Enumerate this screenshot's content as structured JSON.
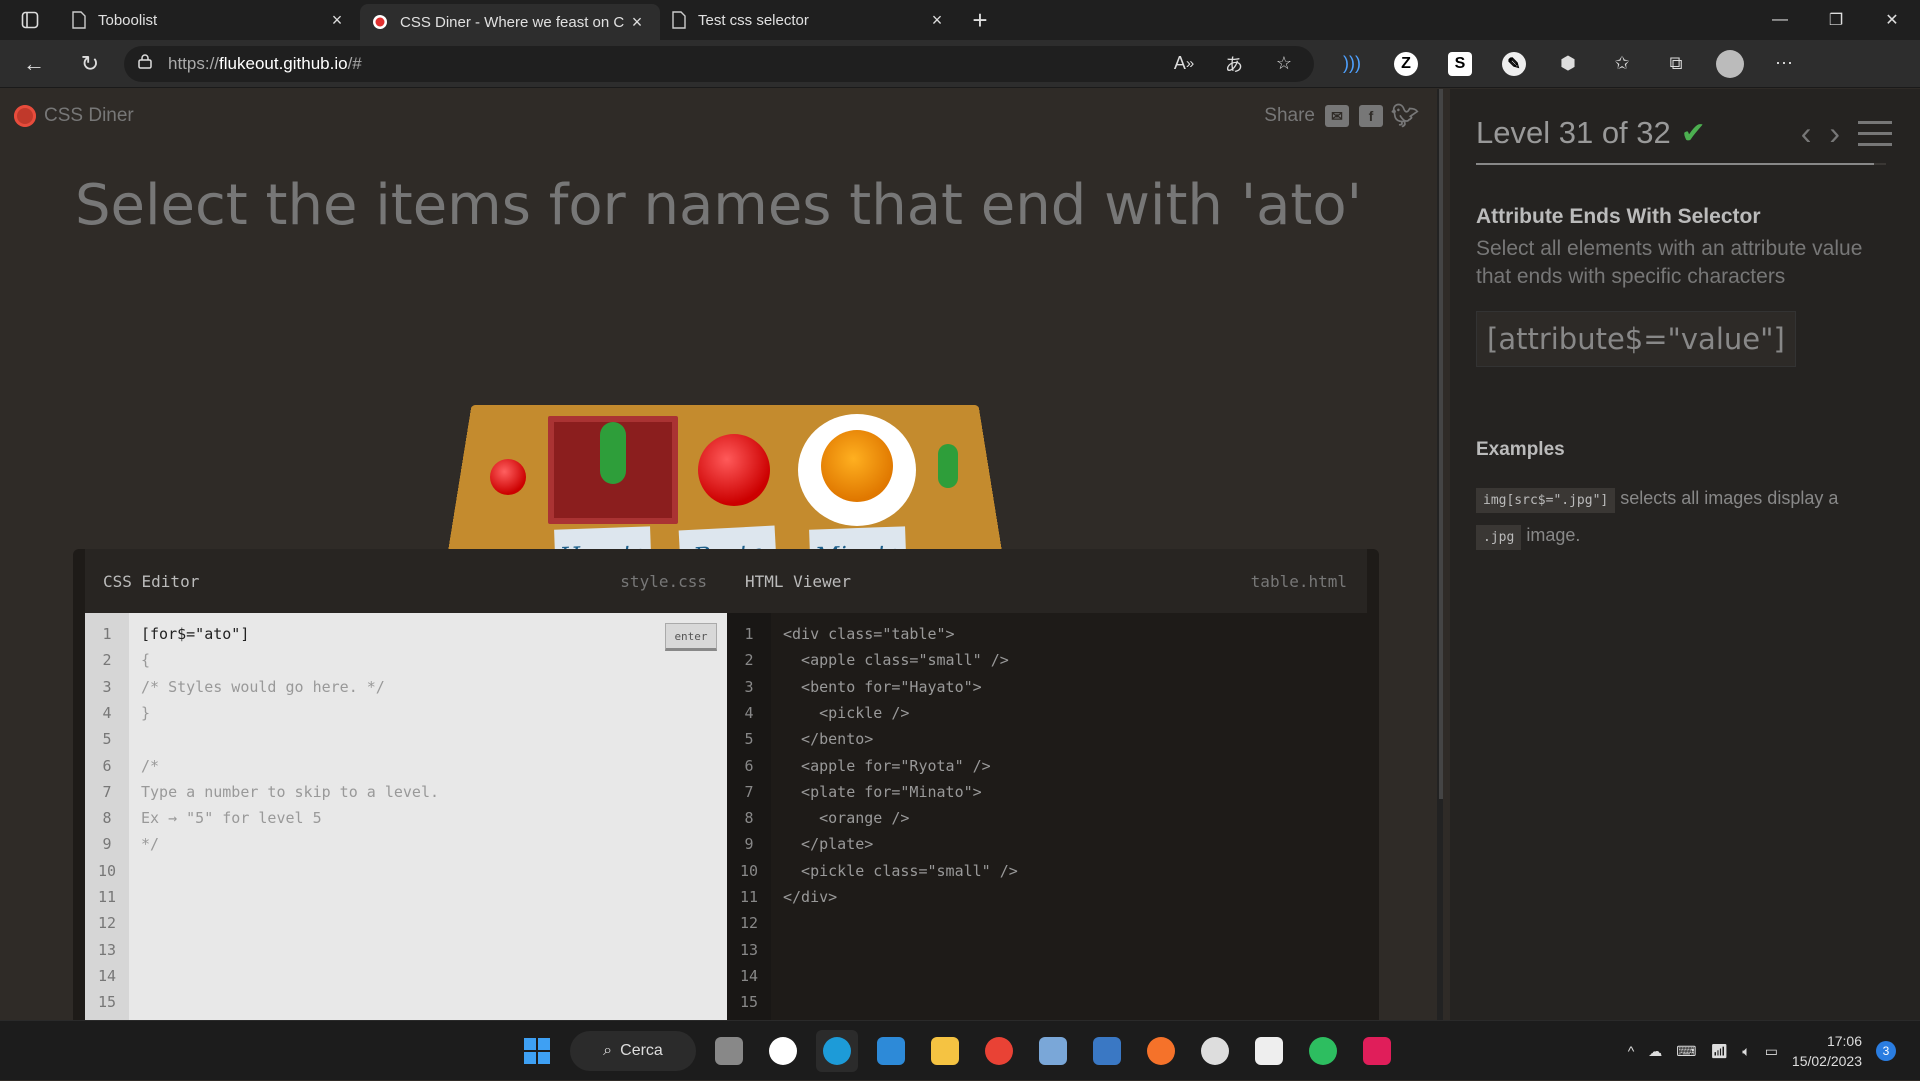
{
  "browser": {
    "tabs": [
      {
        "title": "Toboolist",
        "active": false
      },
      {
        "title": "CSS Diner - Where we feast on C",
        "active": true
      },
      {
        "title": "Test css selector",
        "active": false
      }
    ],
    "url_prefix": "https://",
    "url_host": "flukeout.github.io",
    "url_path": "/#"
  },
  "header": {
    "logo_text": "CSS Diner",
    "share_label": "Share"
  },
  "instruction": "Select the items for names that end with 'ato'",
  "table_tags": [
    "Hayato",
    "Ryota",
    "Minato"
  ],
  "css_editor": {
    "title": "CSS Editor",
    "file": "style.css",
    "enter_label": "enter",
    "lines": [
      "[for$=\"ato\"]",
      "{",
      "/* Styles would go here. */",
      "}",
      "",
      "/*",
      "Type a number to skip to a level.",
      "Ex → \"5\" for level 5",
      "*/",
      "",
      "",
      "",
      "",
      "",
      ""
    ]
  },
  "html_viewer": {
    "title": "HTML Viewer",
    "file": "table.html",
    "lines": [
      "<div class=\"table\">",
      "  <apple class=\"small\" />",
      "  <bento for=\"Hayato\">",
      "    <pickle />",
      "  </bento>",
      "  <apple for=\"Ryota\" />",
      "  <plate for=\"Minato\">",
      "    <orange />",
      "  </plate>",
      "  <pickle class=\"small\" />",
      "</div>",
      "",
      "",
      "",
      ""
    ]
  },
  "sidebar": {
    "level_text": "Level 31 of 32",
    "level_progress": 0.97,
    "selector_name": "Attribute Ends With Selector",
    "selector_desc": "Select all elements with an attribute value that ends with specific characters",
    "syntax": "[attribute$=\"value\"]",
    "examples_title": "Examples",
    "example_code": "img[src$=\".jpg\"]",
    "example_text": "selects all images display a",
    "example_code2": ".jpg",
    "example_text2": "image."
  },
  "taskbar": {
    "search_label": "Cerca",
    "time": "17:06",
    "date": "15/02/2023",
    "notifications": "3"
  },
  "colors": {
    "accent_red": "#c0392b",
    "check_green": "#4caf50",
    "background": "#2f2b27"
  }
}
